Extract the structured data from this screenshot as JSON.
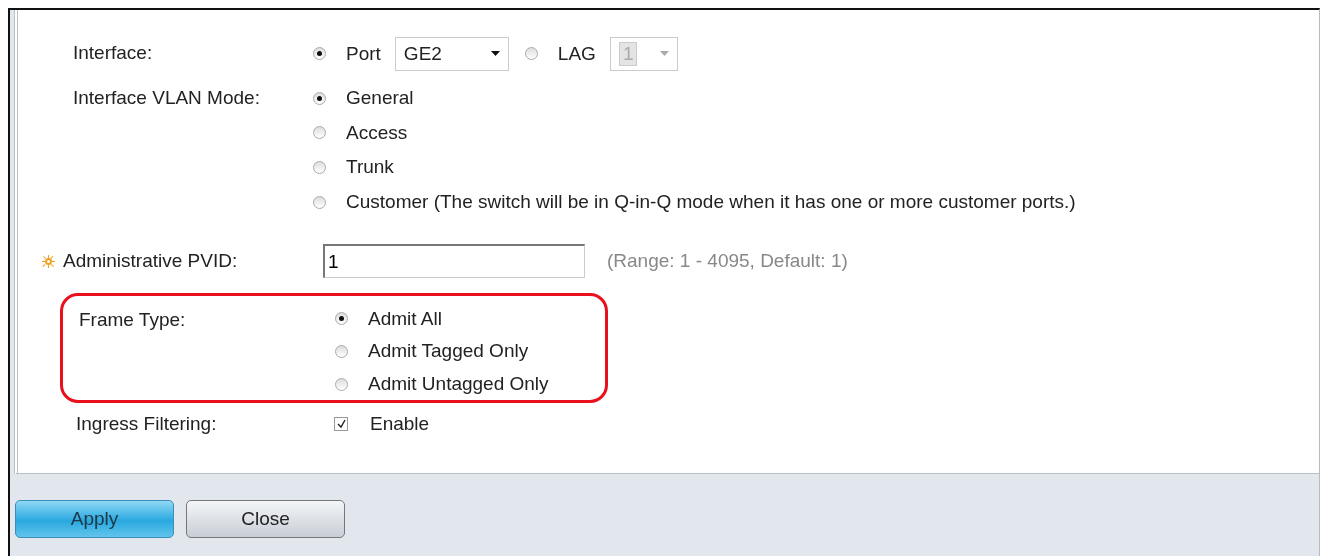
{
  "interface": {
    "label": "Interface:",
    "options": [
      {
        "label": "Port",
        "selected": true,
        "select": {
          "value": "GE2",
          "disabled": false
        }
      },
      {
        "label": "LAG",
        "selected": false,
        "select": {
          "value": "1",
          "disabled": true
        }
      }
    ]
  },
  "vlan_mode": {
    "label": "Interface VLAN Mode:",
    "options": [
      {
        "label": "General",
        "selected": true
      },
      {
        "label": "Access",
        "selected": false
      },
      {
        "label": "Trunk",
        "selected": false
      },
      {
        "label": "Customer (The switch will be in Q-in-Q mode when it has one or more customer ports.)",
        "selected": false
      }
    ]
  },
  "pvid": {
    "label": "Administrative PVID:",
    "required": true,
    "value": "1",
    "hint": "(Range: 1 - 4095, Default: 1)"
  },
  "frame_type": {
    "label": "Frame Type:",
    "highlighted": true,
    "options": [
      {
        "label": "Admit All",
        "selected": true
      },
      {
        "label": "Admit Tagged Only",
        "selected": false
      },
      {
        "label": "Admit Untagged Only",
        "selected": false
      }
    ]
  },
  "ingress": {
    "label": "Ingress Filtering:",
    "checkbox": {
      "label": "Enable",
      "checked": true
    }
  },
  "buttons": [
    {
      "label": "Apply",
      "kind": "primary"
    },
    {
      "label": "Close",
      "kind": "secondary"
    }
  ]
}
